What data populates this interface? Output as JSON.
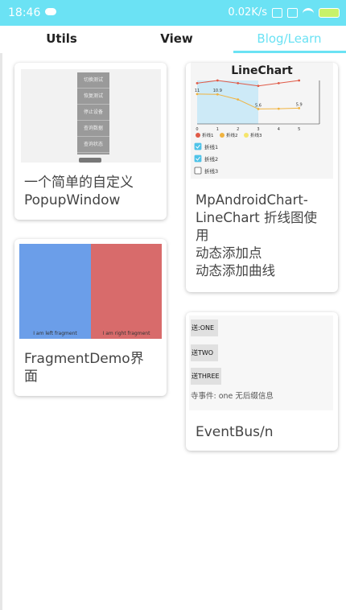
{
  "status_bar": {
    "time": "18:46",
    "net_speed": "0.02K/s"
  },
  "tabs": [
    {
      "label": "Utils",
      "active": false
    },
    {
      "label": "View",
      "active": false
    },
    {
      "label": "Blog/Learn",
      "active": true
    }
  ],
  "accent_color": "#6be2f4",
  "cards": {
    "popup": {
      "title": "一个简单的自定义\nPopupWindow",
      "menu_items": [
        "切换测试",
        "恢复测试",
        "停止设备",
        "查询数据",
        "查询状态"
      ]
    },
    "fragment": {
      "title": "FragmentDemo界\n面",
      "left_label": "I am left fragment",
      "right_label": "I am right fragment",
      "left_color": "#6b9ee9",
      "right_color": "#d86b6b"
    },
    "chart": {
      "preview_title": "LineChart",
      "title": "MpAndroidChart-\nLineChart 折线图使\n用\n动态添加点\n动态添加曲线",
      "legend": [
        "折线1",
        "折线2",
        "折线3"
      ],
      "checkboxes": [
        {
          "label": "折线1",
          "checked": true
        },
        {
          "label": "折线2",
          "checked": true
        },
        {
          "label": "折线3",
          "checked": false
        }
      ]
    },
    "eventbus": {
      "title": "EventBus/n",
      "buttons": [
        "送:ONE",
        "送TWO",
        "送THREE"
      ],
      "event_text": "寺事件: one 无后缀信息"
    }
  },
  "chart_data": {
    "type": "line",
    "title": "LineChart",
    "x": [
      0,
      1,
      2,
      3,
      4,
      5
    ],
    "series": [
      {
        "name": "折线1",
        "values": [
          15,
          16,
          15,
          14,
          15,
          16
        ],
        "color": "#e05a47"
      },
      {
        "name": "折线2",
        "values": [
          11,
          10.9,
          9,
          5.5,
          5.6,
          5.8
        ],
        "color": "#f0b340"
      }
    ],
    "data_labels": [
      "11",
      "10.9",
      "5.6",
      "5.9"
    ],
    "ylim": [
      0,
      16
    ],
    "xlim": [
      0,
      6
    ]
  }
}
